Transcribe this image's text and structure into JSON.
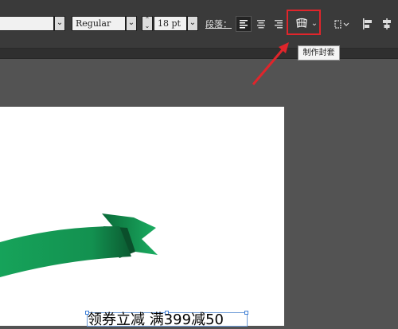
{
  "toolbar": {
    "font_style_value": "Regular",
    "font_size_value": "18 pt",
    "paragraph_label": "段落：",
    "envelope_tooltip": "制作封套"
  },
  "artboard": {
    "text_content": "领券立减 满399减50"
  },
  "icons": [
    "chevron-down-icon",
    "stepper-icon",
    "align-left-icon",
    "align-center-icon",
    "align-right-icon",
    "envelope-distort-icon",
    "transform-icon",
    "align-objects-icon"
  ],
  "colors": {
    "toolbar_bg": "#3a3a3a",
    "canvas_bg": "#535353",
    "highlight": "#e0252b",
    "arrow": "#e0252b",
    "ribbon": "#1a9a56"
  }
}
